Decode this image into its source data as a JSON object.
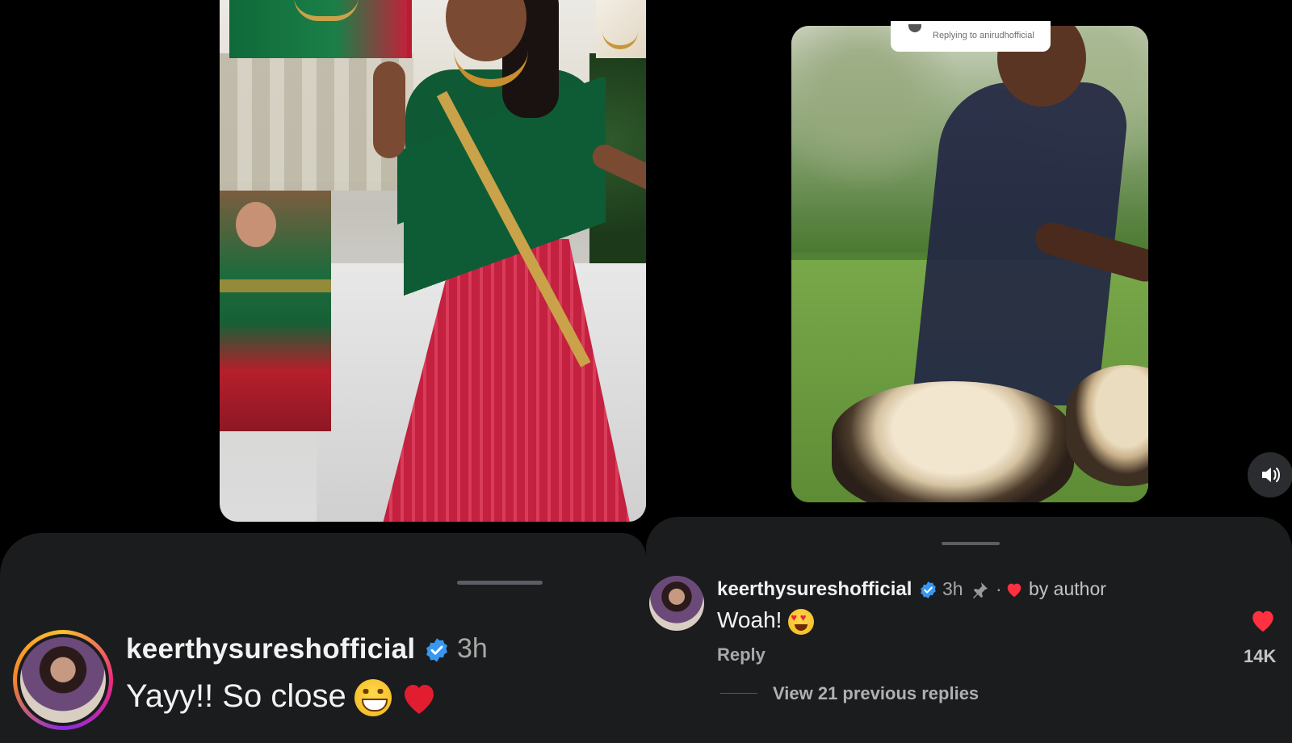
{
  "left_comment": {
    "username": "keerthysureshofficial",
    "time": "3h",
    "text": "Yayy!! So close",
    "emojis": [
      "grinning-face",
      "red-heart"
    ]
  },
  "right_comment": {
    "reply_banner": "Replying to anirudhofficial",
    "username": "keerthysureshofficial",
    "time": "3h",
    "separator": "·",
    "liked_by_label": "by author",
    "text": "Woah!",
    "emoji": "heart-eyes-face",
    "reply_label": "Reply",
    "like_count": "14K",
    "view_replies_label": "View 21 previous replies"
  },
  "colors": {
    "sheet_bg": "#1b1c1e",
    "verified_blue": "#3897f0",
    "heart_red": "#ff3040",
    "muted_text": "#a8a8a8"
  }
}
